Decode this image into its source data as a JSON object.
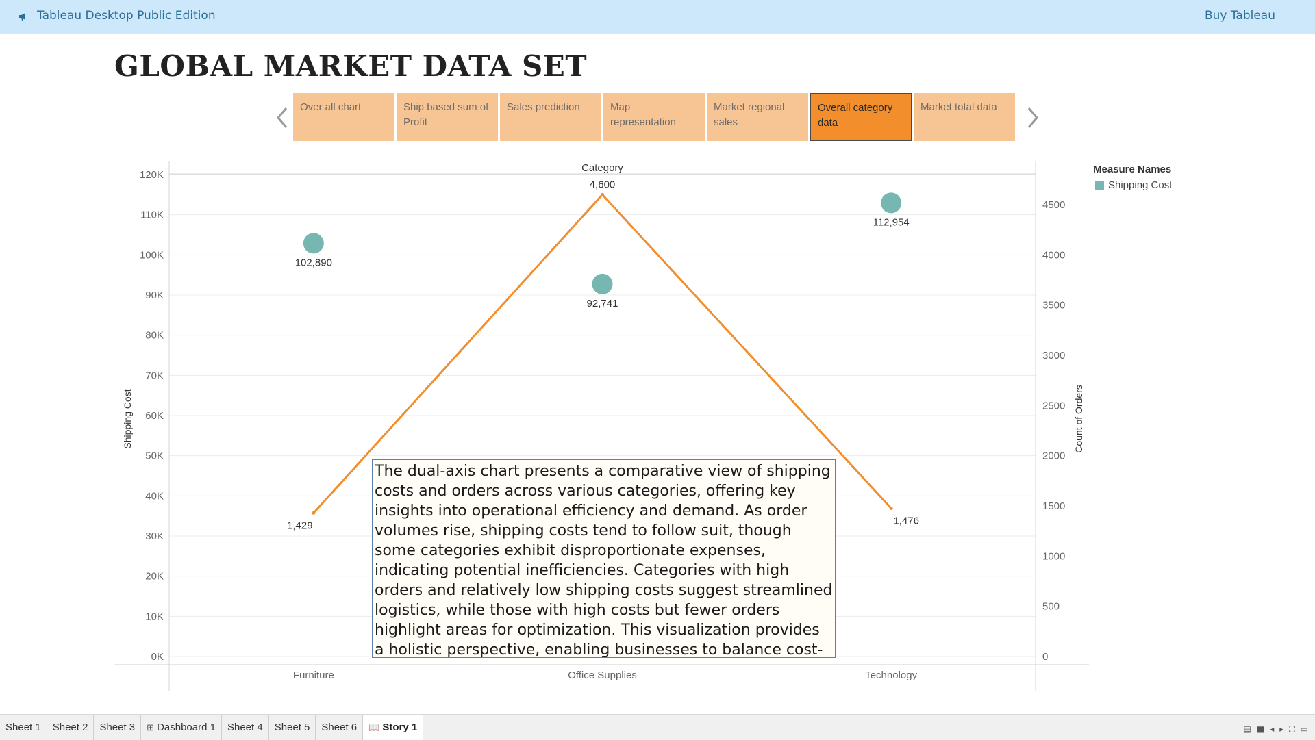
{
  "topbar": {
    "app_title": "Tableau Desktop Public Edition",
    "buy_label": "Buy Tableau"
  },
  "story": {
    "title": "GLOBAL MARKET DATA SET",
    "points": [
      "Over all chart",
      "Ship based sum of Profit",
      "Sales prediction",
      "Map representation",
      "Market regional sales",
      "Overall category data",
      "Market total data"
    ],
    "active_index": 5
  },
  "legend": {
    "title": "Measure Names",
    "items": [
      {
        "label": "Shipping Cost",
        "color": "#76b7b2"
      }
    ]
  },
  "chart_data": {
    "type": "dual-axis",
    "column_header": "Category",
    "categories": [
      "Furniture",
      "Office Supplies",
      "Technology"
    ],
    "left_axis": {
      "label": "Shipping Cost",
      "range": [
        0,
        120000
      ],
      "ticks": [
        0,
        10000,
        20000,
        30000,
        40000,
        50000,
        60000,
        70000,
        80000,
        90000,
        100000,
        110000,
        120000
      ],
      "tick_labels": [
        "0K",
        "10K",
        "20K",
        "30K",
        "40K",
        "50K",
        "60K",
        "70K",
        "80K",
        "90K",
        "100K",
        "110K",
        "120K"
      ]
    },
    "right_axis": {
      "label": "Count of Orders",
      "range": [
        0,
        4800
      ],
      "ticks": [
        0,
        500,
        1000,
        1500,
        2000,
        2500,
        3000,
        3500,
        4000,
        4500
      ],
      "tick_labels": [
        "0",
        "500",
        "1000",
        "1500",
        "2000",
        "2500",
        "3000",
        "3500",
        "4000",
        "4500"
      ]
    },
    "series": [
      {
        "name": "Shipping Cost",
        "mark": "circle",
        "axis": "left",
        "color": "#76b7b2",
        "values": [
          102890,
          92741,
          112954
        ],
        "labels": [
          "102,890",
          "92,741",
          "112,954"
        ]
      },
      {
        "name": "Count of Orders",
        "mark": "line",
        "axis": "right",
        "color": "#f28e2b",
        "values": [
          1429,
          4600,
          1476
        ],
        "labels": [
          "1,429",
          "4,600",
          "1,476"
        ]
      }
    ],
    "grid": true
  },
  "annotation": {
    "text": "The dual-axis chart presents a comparative view of shipping costs and orders across various categories, offering key insights into operational efficiency and demand. As order volumes rise, shipping costs tend to follow suit, though some categories exhibit disproportionate expenses, indicating potential inefficiencies. Categories with high orders and relatively low shipping costs suggest streamlined logistics, while those with high costs but fewer orders highlight areas for optimization. This visualization provides a holistic perspective, enabling businesses to balance cost-effectiveness with customer dema.."
  },
  "tabs": [
    {
      "label": "Sheet 1",
      "icon": ""
    },
    {
      "label": "Sheet 2",
      "icon": ""
    },
    {
      "label": "Sheet 3",
      "icon": ""
    },
    {
      "label": "Dashboard 1",
      "icon": "dashboard-icon"
    },
    {
      "label": "Sheet 4",
      "icon": ""
    },
    {
      "label": "Sheet 5",
      "icon": ""
    },
    {
      "label": "Sheet 6",
      "icon": ""
    },
    {
      "label": "Story 1",
      "icon": "story-icon"
    }
  ],
  "active_tab": 7
}
